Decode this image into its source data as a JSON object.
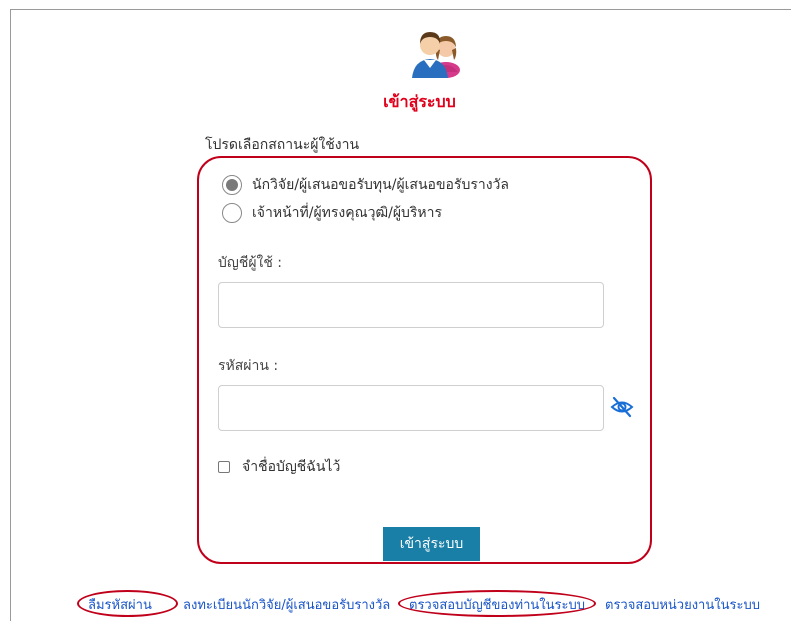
{
  "header": {
    "title": "เข้าสู่ระบบ"
  },
  "status_label": "โปรดเลือกสถานะผู้ใช้งาน",
  "user_types": [
    {
      "label": "นักวิจัย/ผู้เสนอขอรับทุน/ผู้เสนอขอรับรางวัล",
      "selected": true
    },
    {
      "label": "เจ้าหน้าที่/ผู้ทรงคุณวุฒิ/ผู้บริหาร",
      "selected": false
    }
  ],
  "username": {
    "label": "บัญชีผู้ใช้ :",
    "value": "",
    "placeholder": ""
  },
  "password": {
    "label": "รหัสผ่าน :",
    "value": "",
    "placeholder": ""
  },
  "remember": {
    "label": "จำชื่อบัญชีฉันไว้",
    "checked": false
  },
  "login_button": "เข้าสู่ระบบ",
  "footer": {
    "forgot_password": "ลืมรหัสผ่าน",
    "register": "ลงทะเบียนนักวิจัย/ผู้เสนอขอรับรางวัล",
    "check_account": "ตรวจสอบบัญชีของท่านในระบบ",
    "check_unit": "ตรวจสอบหน่วยงานในระบบ"
  },
  "colors": {
    "title_red": "#e0001b",
    "highlight_red": "#c0001a",
    "button_blue": "#1a7fa6",
    "link_blue": "#1a55c7",
    "eye_icon_blue": "#1a6fd6"
  },
  "icons": {
    "avatar": "users-avatar-icon",
    "password_toggle": "eye-slash-icon"
  }
}
